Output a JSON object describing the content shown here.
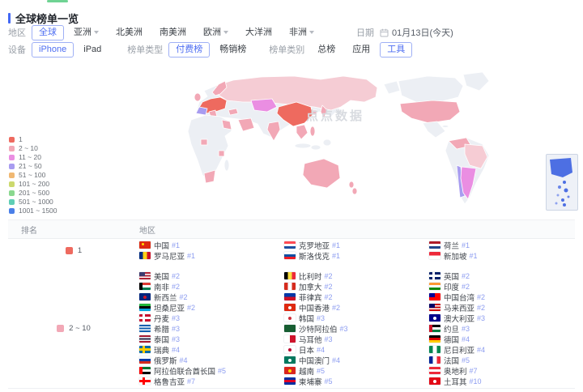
{
  "header": {
    "title": "全球榜单一览"
  },
  "filters": {
    "region_label": "地区",
    "regions": [
      {
        "label": "全球",
        "selected": true
      },
      {
        "label": "亚洲",
        "caret": true
      },
      {
        "label": "北美洲"
      },
      {
        "label": "南美洲"
      },
      {
        "label": "欧洲",
        "caret": true
      },
      {
        "label": "大洋洲"
      },
      {
        "label": "非洲",
        "caret": true
      }
    ],
    "date_label": "日期",
    "date_value": "01月13日(今天)",
    "device_label": "设备",
    "devices": [
      {
        "label": "iPhone",
        "selected": true
      },
      {
        "label": "iPad"
      }
    ],
    "list_type_label": "榜单类型",
    "list_types": [
      {
        "label": "付费榜",
        "selected": true
      },
      {
        "label": "畅销榜"
      }
    ],
    "category_label": "榜单类别",
    "categories": [
      {
        "label": "总榜"
      },
      {
        "label": "应用"
      },
      {
        "label": "工具",
        "selected": true
      }
    ]
  },
  "map": {
    "watermark": "点点数据"
  },
  "legend": [
    {
      "label": "1",
      "color": "#ee6a5f"
    },
    {
      "label": "2 ~ 10",
      "color": "#f2a8b6"
    },
    {
      "label": "11 ~ 20",
      "color": "#ea8ee2"
    },
    {
      "label": "21 ~ 50",
      "color": "#a89cf0"
    },
    {
      "label": "51 ~ 100",
      "color": "#f0b873"
    },
    {
      "label": "101 ~ 200",
      "color": "#ccd96e"
    },
    {
      "label": "201 ~ 500",
      "color": "#8ad88f"
    },
    {
      "label": "501 ~ 1000",
      "color": "#5fceb5"
    },
    {
      "label": "1001 ~ 1500",
      "color": "#4a7fe8"
    }
  ],
  "table": {
    "headers": {
      "rank": "排名",
      "region": "地区"
    },
    "groups": [
      {
        "rank_label": "1",
        "rank_color": "#ee6a5f",
        "columns": [
          [
            {
              "name": "中国",
              "rank": "#1",
              "flag": {
                "t": "s",
                "c": [
                  "#de2910"
                ],
                "dot": "#ffde00",
                "dp": "tl"
              }
            },
            {
              "name": "罗马尼亚",
              "rank": "#1",
              "flag": {
                "t": "v",
                "c": [
                  "#002b7f",
                  "#fcd116",
                  "#ce1126"
                ]
              }
            }
          ],
          [
            {
              "name": "克罗地亚",
              "rank": "#1",
              "flag": {
                "t": "h",
                "c": [
                  "#ff4b55",
                  "#ffffff",
                  "#1e50a0"
                ]
              }
            },
            {
              "name": "斯洛伐克",
              "rank": "#1",
              "flag": {
                "t": "h",
                "c": [
                  "#ffffff",
                  "#0b4ea2",
                  "#ee1c25"
                ]
              }
            }
          ],
          [
            {
              "name": "荷兰",
              "rank": "#1",
              "flag": {
                "t": "h",
                "c": [
                  "#ae1c28",
                  "#ffffff",
                  "#21468b"
                ]
              }
            },
            {
              "name": "新加坡",
              "rank": "#1",
              "flag": {
                "t": "h",
                "c": [
                  "#ed2939",
                  "#ffffff"
                ]
              }
            }
          ]
        ]
      },
      {
        "rank_label": "2 ~ 10",
        "rank_color": "#f2a8b6",
        "columns": [
          [
            {
              "name": "美国",
              "rank": "#2",
              "flag": {
                "t": "h",
                "c": [
                  "#b22234",
                  "#ffffff",
                  "#b22234",
                  "#ffffff",
                  "#b22234"
                ],
                "canton": "#3c3b6e"
              }
            },
            {
              "name": "南非",
              "rank": "#2",
              "flag": {
                "t": "h",
                "c": [
                  "#de3831",
                  "#ffffff",
                  "#007a4d"
                ],
                "bar": "#000000"
              }
            },
            {
              "name": "新西兰",
              "rank": "#2",
              "flag": {
                "t": "s",
                "c": [
                  "#00247d"
                ],
                "dot": "#cc142b"
              }
            },
            {
              "name": "坦桑尼亚",
              "rank": "#2",
              "flag": {
                "t": "h",
                "c": [
                  "#1eb53a",
                  "#000000",
                  "#00a3dd"
                ]
              }
            },
            {
              "name": "丹麦",
              "rank": "#3",
              "flag": {
                "t": "c",
                "c": [
                  "#c8102e",
                  "#ffffff"
                ]
              }
            },
            {
              "name": "希腊",
              "rank": "#3",
              "flag": {
                "t": "h",
                "c": [
                  "#0d5eaf",
                  "#ffffff",
                  "#0d5eaf",
                  "#ffffff",
                  "#0d5eaf"
                ]
              }
            },
            {
              "name": "泰国",
              "rank": "#3",
              "flag": {
                "t": "h",
                "c": [
                  "#a51931",
                  "#f4f5f8",
                  "#2d2a4a",
                  "#f4f5f8",
                  "#a51931"
                ]
              }
            },
            {
              "name": "瑞典",
              "rank": "#4",
              "flag": {
                "t": "c",
                "c": [
                  "#006aa7",
                  "#fecc00"
                ]
              }
            },
            {
              "name": "俄罗斯",
              "rank": "#4",
              "flag": {
                "t": "h",
                "c": [
                  "#ffffff",
                  "#0039a6",
                  "#d52b1e"
                ]
              }
            },
            {
              "name": "阿拉伯联合酋长国",
              "rank": "#5",
              "flag": {
                "t": "h",
                "c": [
                  "#00732f",
                  "#ffffff",
                  "#000000"
                ],
                "bar": "#ff0000"
              }
            },
            {
              "name": "格鲁吉亚",
              "rank": "#7",
              "flag": {
                "t": "c",
                "c": [
                  "#ffffff",
                  "#ff0000"
                ]
              }
            }
          ],
          [
            {
              "name": "比利时",
              "rank": "#2",
              "flag": {
                "t": "v",
                "c": [
                  "#000000",
                  "#fae042",
                  "#ed2939"
                ]
              }
            },
            {
              "name": "加拿大",
              "rank": "#2",
              "flag": {
                "t": "v",
                "c": [
                  "#d52b1e",
                  "#ffffff",
                  "#d52b1e"
                ]
              }
            },
            {
              "name": "菲律宾",
              "rank": "#2",
              "flag": {
                "t": "h",
                "c": [
                  "#0038a8",
                  "#ce1126"
                ]
              }
            },
            {
              "name": "中国香港",
              "rank": "#2",
              "flag": {
                "t": "s",
                "c": [
                  "#de2910"
                ],
                "dot": "#ffffff"
              }
            },
            {
              "name": "韩国",
              "rank": "#3",
              "flag": {
                "t": "s",
                "c": [
                  "#ffffff"
                ],
                "dot": "#cd2e3a"
              }
            },
            {
              "name": "沙特阿拉伯",
              "rank": "#3",
              "flag": {
                "t": "s",
                "c": [
                  "#165d31"
                ]
              }
            },
            {
              "name": "马耳他",
              "rank": "#3",
              "flag": {
                "t": "v",
                "c": [
                  "#ffffff",
                  "#cf142b"
                ]
              }
            },
            {
              "name": "日本",
              "rank": "#4",
              "flag": {
                "t": "s",
                "c": [
                  "#ffffff"
                ],
                "dot": "#bc002d"
              }
            },
            {
              "name": "中国澳门",
              "rank": "#4",
              "flag": {
                "t": "s",
                "c": [
                  "#00785e"
                ],
                "dot": "#ffffff"
              }
            },
            {
              "name": "越南",
              "rank": "#5",
              "flag": {
                "t": "s",
                "c": [
                  "#da251d"
                ],
                "dot": "#ffde00"
              }
            },
            {
              "name": "柬埔寨",
              "rank": "#5",
              "flag": {
                "t": "h",
                "c": [
                  "#032ea1",
                  "#e00025",
                  "#032ea1"
                ]
              }
            }
          ],
          [
            {
              "name": "英国",
              "rank": "#2",
              "flag": {
                "t": "c",
                "c": [
                  "#012169",
                  "#ffffff"
                ]
              }
            },
            {
              "name": "印度",
              "rank": "#2",
              "flag": {
                "t": "h",
                "c": [
                  "#ff9933",
                  "#ffffff",
                  "#138808"
                ]
              }
            },
            {
              "name": "中国台湾",
              "rank": "#2",
              "flag": {
                "t": "s",
                "c": [
                  "#fe0000"
                ],
                "canton": "#000095"
              }
            },
            {
              "name": "马来西亚",
              "rank": "#2",
              "flag": {
                "t": "h",
                "c": [
                  "#cc0001",
                  "#ffffff",
                  "#cc0001",
                  "#ffffff",
                  "#cc0001"
                ],
                "canton": "#010066"
              }
            },
            {
              "name": "澳大利亚",
              "rank": "#3",
              "flag": {
                "t": "s",
                "c": [
                  "#00008b"
                ],
                "dot": "#ffffff"
              }
            },
            {
              "name": "约旦",
              "rank": "#3",
              "flag": {
                "t": "h",
                "c": [
                  "#000000",
                  "#ffffff",
                  "#007a3d"
                ],
                "bar": "#ce1126"
              }
            },
            {
              "name": "德国",
              "rank": "#4",
              "flag": {
                "t": "h",
                "c": [
                  "#000000",
                  "#dd0000",
                  "#ffce00"
                ]
              }
            },
            {
              "name": "尼日利亚",
              "rank": "#4",
              "flag": {
                "t": "v",
                "c": [
                  "#008751",
                  "#ffffff",
                  "#008751"
                ]
              }
            },
            {
              "name": "法国",
              "rank": "#5",
              "flag": {
                "t": "v",
                "c": [
                  "#002395",
                  "#ffffff",
                  "#ed2939"
                ]
              }
            },
            {
              "name": "奥地利",
              "rank": "#7",
              "flag": {
                "t": "h",
                "c": [
                  "#ed2939",
                  "#ffffff",
                  "#ed2939"
                ]
              }
            },
            {
              "name": "土耳其",
              "rank": "#10",
              "flag": {
                "t": "s",
                "c": [
                  "#e30a17"
                ],
                "dot": "#ffffff"
              }
            }
          ]
        ]
      }
    ]
  }
}
